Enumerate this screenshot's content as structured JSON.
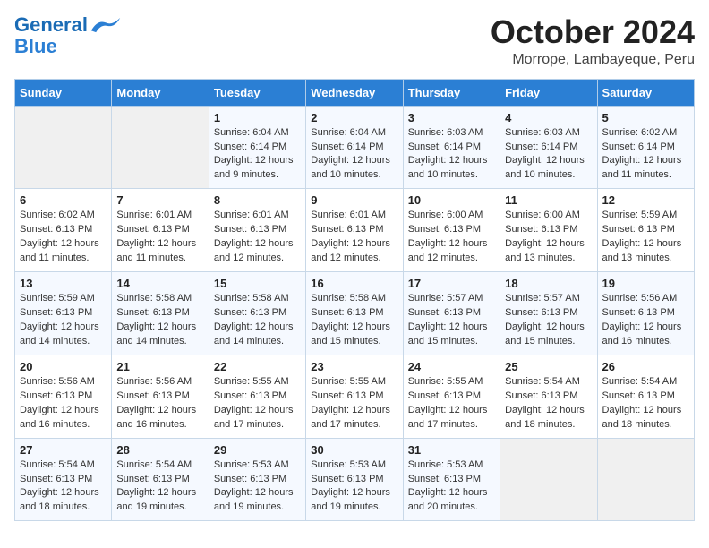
{
  "header": {
    "logo_line1": "General",
    "logo_line2": "Blue",
    "month": "October 2024",
    "location": "Morrope, Lambayeque, Peru"
  },
  "weekdays": [
    "Sunday",
    "Monday",
    "Tuesday",
    "Wednesday",
    "Thursday",
    "Friday",
    "Saturday"
  ],
  "weeks": [
    [
      {
        "day": "",
        "info": ""
      },
      {
        "day": "",
        "info": ""
      },
      {
        "day": "1",
        "info": "Sunrise: 6:04 AM\nSunset: 6:14 PM\nDaylight: 12 hours and 9 minutes."
      },
      {
        "day": "2",
        "info": "Sunrise: 6:04 AM\nSunset: 6:14 PM\nDaylight: 12 hours and 10 minutes."
      },
      {
        "day": "3",
        "info": "Sunrise: 6:03 AM\nSunset: 6:14 PM\nDaylight: 12 hours and 10 minutes."
      },
      {
        "day": "4",
        "info": "Sunrise: 6:03 AM\nSunset: 6:14 PM\nDaylight: 12 hours and 10 minutes."
      },
      {
        "day": "5",
        "info": "Sunrise: 6:02 AM\nSunset: 6:14 PM\nDaylight: 12 hours and 11 minutes."
      }
    ],
    [
      {
        "day": "6",
        "info": "Sunrise: 6:02 AM\nSunset: 6:13 PM\nDaylight: 12 hours and 11 minutes."
      },
      {
        "day": "7",
        "info": "Sunrise: 6:01 AM\nSunset: 6:13 PM\nDaylight: 12 hours and 11 minutes."
      },
      {
        "day": "8",
        "info": "Sunrise: 6:01 AM\nSunset: 6:13 PM\nDaylight: 12 hours and 12 minutes."
      },
      {
        "day": "9",
        "info": "Sunrise: 6:01 AM\nSunset: 6:13 PM\nDaylight: 12 hours and 12 minutes."
      },
      {
        "day": "10",
        "info": "Sunrise: 6:00 AM\nSunset: 6:13 PM\nDaylight: 12 hours and 12 minutes."
      },
      {
        "day": "11",
        "info": "Sunrise: 6:00 AM\nSunset: 6:13 PM\nDaylight: 12 hours and 13 minutes."
      },
      {
        "day": "12",
        "info": "Sunrise: 5:59 AM\nSunset: 6:13 PM\nDaylight: 12 hours and 13 minutes."
      }
    ],
    [
      {
        "day": "13",
        "info": "Sunrise: 5:59 AM\nSunset: 6:13 PM\nDaylight: 12 hours and 14 minutes."
      },
      {
        "day": "14",
        "info": "Sunrise: 5:58 AM\nSunset: 6:13 PM\nDaylight: 12 hours and 14 minutes."
      },
      {
        "day": "15",
        "info": "Sunrise: 5:58 AM\nSunset: 6:13 PM\nDaylight: 12 hours and 14 minutes."
      },
      {
        "day": "16",
        "info": "Sunrise: 5:58 AM\nSunset: 6:13 PM\nDaylight: 12 hours and 15 minutes."
      },
      {
        "day": "17",
        "info": "Sunrise: 5:57 AM\nSunset: 6:13 PM\nDaylight: 12 hours and 15 minutes."
      },
      {
        "day": "18",
        "info": "Sunrise: 5:57 AM\nSunset: 6:13 PM\nDaylight: 12 hours and 15 minutes."
      },
      {
        "day": "19",
        "info": "Sunrise: 5:56 AM\nSunset: 6:13 PM\nDaylight: 12 hours and 16 minutes."
      }
    ],
    [
      {
        "day": "20",
        "info": "Sunrise: 5:56 AM\nSunset: 6:13 PM\nDaylight: 12 hours and 16 minutes."
      },
      {
        "day": "21",
        "info": "Sunrise: 5:56 AM\nSunset: 6:13 PM\nDaylight: 12 hours and 16 minutes."
      },
      {
        "day": "22",
        "info": "Sunrise: 5:55 AM\nSunset: 6:13 PM\nDaylight: 12 hours and 17 minutes."
      },
      {
        "day": "23",
        "info": "Sunrise: 5:55 AM\nSunset: 6:13 PM\nDaylight: 12 hours and 17 minutes."
      },
      {
        "day": "24",
        "info": "Sunrise: 5:55 AM\nSunset: 6:13 PM\nDaylight: 12 hours and 17 minutes."
      },
      {
        "day": "25",
        "info": "Sunrise: 5:54 AM\nSunset: 6:13 PM\nDaylight: 12 hours and 18 minutes."
      },
      {
        "day": "26",
        "info": "Sunrise: 5:54 AM\nSunset: 6:13 PM\nDaylight: 12 hours and 18 minutes."
      }
    ],
    [
      {
        "day": "27",
        "info": "Sunrise: 5:54 AM\nSunset: 6:13 PM\nDaylight: 12 hours and 18 minutes."
      },
      {
        "day": "28",
        "info": "Sunrise: 5:54 AM\nSunset: 6:13 PM\nDaylight: 12 hours and 19 minutes."
      },
      {
        "day": "29",
        "info": "Sunrise: 5:53 AM\nSunset: 6:13 PM\nDaylight: 12 hours and 19 minutes."
      },
      {
        "day": "30",
        "info": "Sunrise: 5:53 AM\nSunset: 6:13 PM\nDaylight: 12 hours and 19 minutes."
      },
      {
        "day": "31",
        "info": "Sunrise: 5:53 AM\nSunset: 6:13 PM\nDaylight: 12 hours and 20 minutes."
      },
      {
        "day": "",
        "info": ""
      },
      {
        "day": "",
        "info": ""
      }
    ]
  ]
}
